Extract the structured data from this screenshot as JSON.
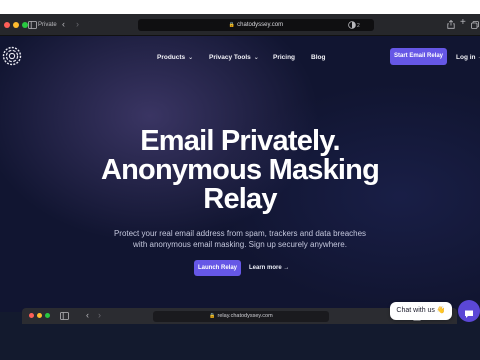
{
  "browser": {
    "private_label": "Private",
    "url": "chatodyssey.com",
    "extension_badge": "2"
  },
  "nav": {
    "items": [
      {
        "label": "Products",
        "dropdown": true
      },
      {
        "label": "Privacy Tools",
        "dropdown": true
      },
      {
        "label": "Pricing",
        "dropdown": false
      },
      {
        "label": "Blog",
        "dropdown": false
      }
    ],
    "cta": "Start Email Relay",
    "login": "Log in →"
  },
  "hero": {
    "headline_line1": "Email Privately.",
    "headline_line2": "Anonymous Masking",
    "headline_line3": "Relay",
    "sub_line1": "Protect your real email address from spam, trackers and data breaches",
    "sub_line2": "with anonymous email masking. Sign up securely anywhere.",
    "primary_button": "Launch Relay",
    "secondary_link": "Learn more →"
  },
  "inner_browser": {
    "url": "relay.chatodyssey.com"
  },
  "chat": {
    "bubble": "Chat with us 👋"
  },
  "colors": {
    "accent": "#6657e6",
    "background": "#111531",
    "chat_button": "#5b47d6"
  }
}
